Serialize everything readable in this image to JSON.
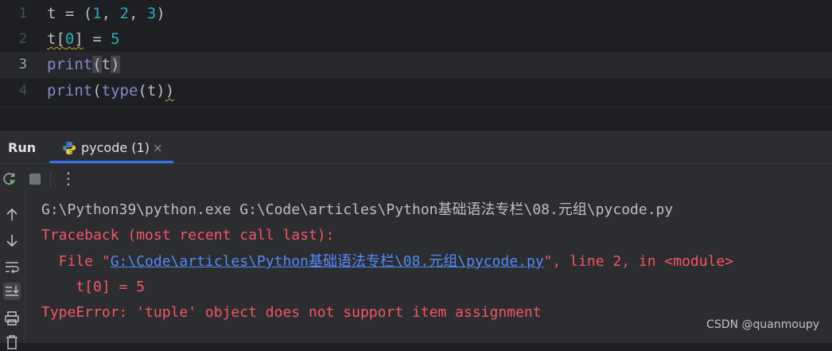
{
  "editor": {
    "lines": [
      {
        "number": "1",
        "t1": "t = (",
        "n1": "1",
        "t2": ", ",
        "n2": "2",
        "t3": ", ",
        "n3": "3",
        "t4": ")"
      },
      {
        "number": "2",
        "t1": "t[",
        "n1": "0",
        "t2": "] = ",
        "n2": "5"
      },
      {
        "number": "3",
        "kw": "print",
        "t1": "(",
        "t2": "t",
        "t3": ")"
      },
      {
        "number": "4",
        "kw1": "print",
        "t1": "(",
        "kw2": "type",
        "t2": "(t)",
        "t3": ")"
      }
    ]
  },
  "run_panel": {
    "title": "Run",
    "tab_label": "pycode (1)",
    "tab_close": "×"
  },
  "toolbar": {
    "icons": [
      "rerun-icon",
      "stop-icon",
      "more-icon"
    ],
    "more_glyph": "⋮"
  },
  "console": {
    "command": "G:\\Python39\\python.exe G:\\Code\\articles\\Python基础语法专栏\\08.元组\\pycode.py",
    "traceback": "Traceback (most recent call last):",
    "file_prefix": "  File \"",
    "file_link": "G:\\Code\\articles\\Python基础语法专栏\\08.元组\\pycode.py",
    "file_suffix": "\", line 2, in <module>",
    "code_line": "    t[0] = 5",
    "error": "TypeError: 'tuple' object does not support item assignment"
  },
  "watermark": "CSDN @quanmoupy",
  "colors": {
    "accent": "#3574f0",
    "error": "#f75464",
    "link": "#548af7",
    "number": "#2aacb8",
    "builtin": "#8888c6"
  }
}
